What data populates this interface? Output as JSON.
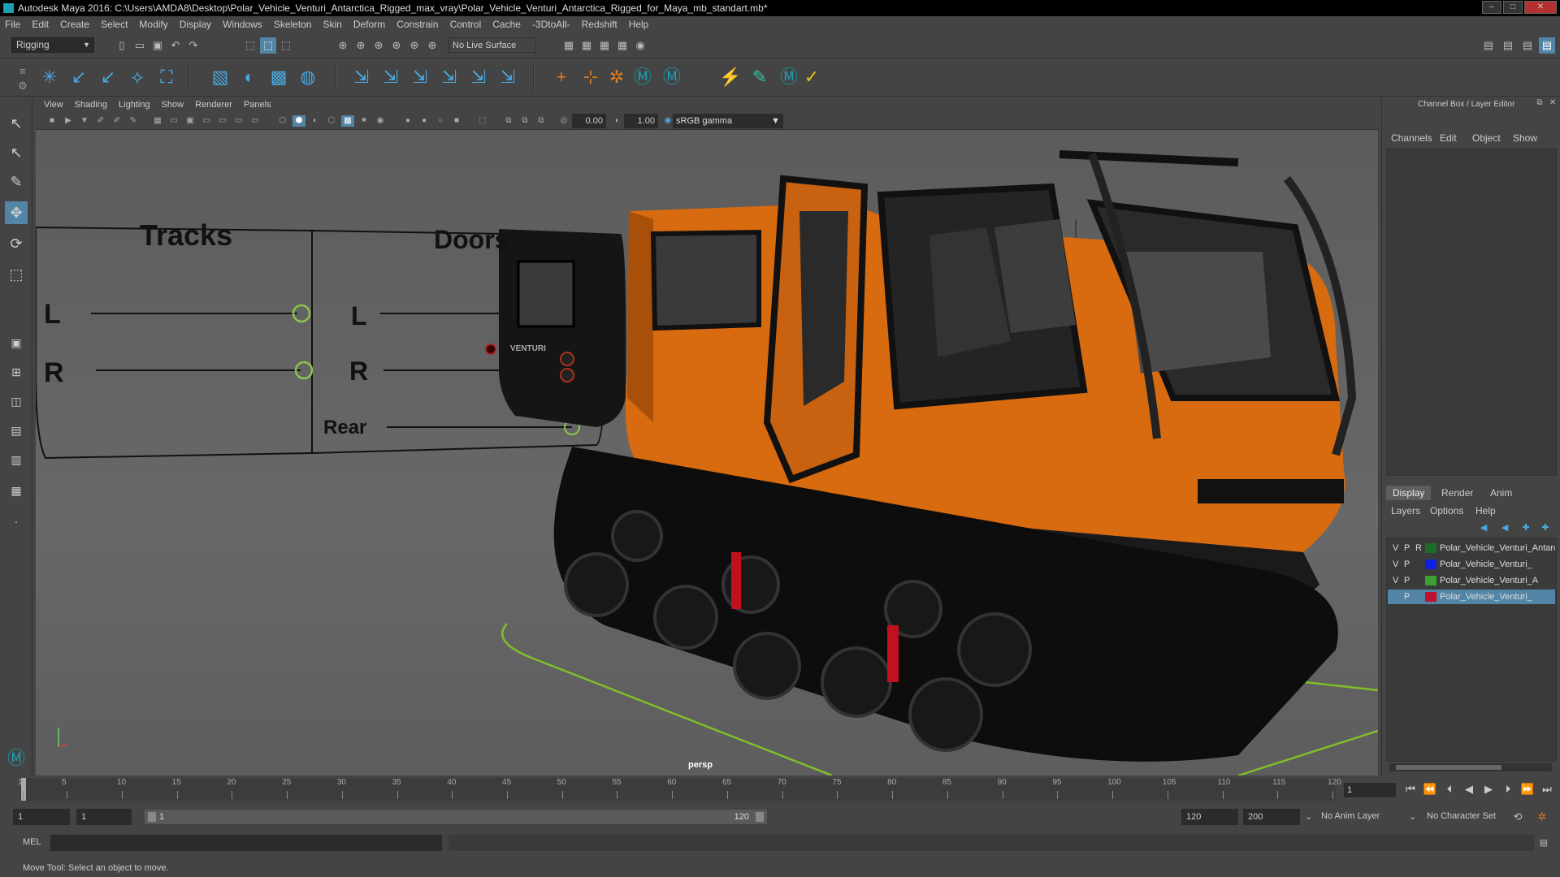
{
  "title": "Autodesk Maya 2016: C:\\Users\\AMDA8\\Desktop\\Polar_Vehicle_Venturi_Antarctica_Rigged_max_vray\\Polar_Vehicle_Venturi_Antarctica_Rigged_for_Maya_mb_standart.mb*",
  "menubar": [
    "File",
    "Edit",
    "Create",
    "Select",
    "Modify",
    "Display",
    "Windows",
    "Skeleton",
    "Skin",
    "Deform",
    "Constrain",
    "Control",
    "Cache",
    "-3DtoAll-",
    "Redshift",
    "Help"
  ],
  "status": {
    "mode": "Rigging",
    "live_surface": "No Live Surface"
  },
  "panel_menu": [
    "View",
    "Shading",
    "Lighting",
    "Show",
    "Renderer",
    "Panels"
  ],
  "panel_toolbar": {
    "exposure": "0.00",
    "gamma": "1.00",
    "color_space": "sRGB gamma"
  },
  "viewport": {
    "camera": "persp",
    "rig": {
      "tracks_title": "Tracks",
      "doors_title": "Doors",
      "left": "L",
      "right": "R",
      "rear": "Rear",
      "logo": "VENTURI"
    }
  },
  "channel_box": {
    "title": "Channel Box / Layer Editor",
    "menu": [
      "Channels",
      "Edit",
      "Object",
      "Show"
    ],
    "tabs": [
      "Display",
      "Render",
      "Anim"
    ],
    "layer_menu": [
      "Layers",
      "Options",
      "Help"
    ],
    "layers": [
      {
        "v": "V",
        "p": "P",
        "r": "R",
        "color": "#1e6b2a",
        "name": "Polar_Vehicle_Venturi_Antarctica"
      },
      {
        "v": "V",
        "p": "P",
        "r": "",
        "color": "#1020e0",
        "name": "Polar_Vehicle_Venturi_"
      },
      {
        "v": "V",
        "p": "P",
        "r": "",
        "color": "#3aa030",
        "name": "Polar_Vehicle_Venturi_A"
      },
      {
        "v": "",
        "p": "P",
        "r": "",
        "color": "#c01030",
        "name": "Polar_Vehicle_Venturi_"
      }
    ]
  },
  "timeline": {
    "labels": [
      "1",
      "5",
      "10",
      "15",
      "20",
      "25",
      "30",
      "35",
      "40",
      "45",
      "50",
      "55",
      "60",
      "65",
      "70",
      "75",
      "80",
      "85",
      "90",
      "95",
      "100",
      "105",
      "110",
      "115",
      "120"
    ],
    "current_frame": "1"
  },
  "range": {
    "start": "1",
    "start_inner": "1",
    "slider_start": "1",
    "slider_end": "120",
    "end_inner": "120",
    "end": "200",
    "anim_layer": "No Anim Layer",
    "char_set": "No Character Set"
  },
  "cmd": {
    "label": "MEL"
  },
  "help_line": "Move Tool: Select an object to move."
}
